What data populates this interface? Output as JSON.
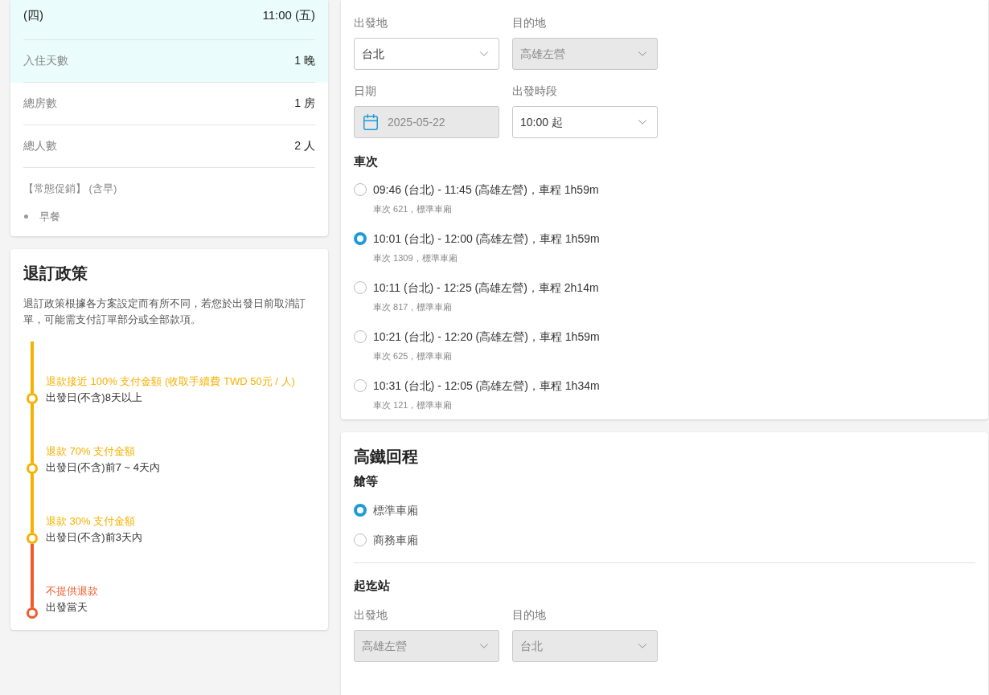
{
  "stay_summary": {
    "rows": [
      {
        "kind": "date",
        "label": "(四)",
        "value": "11:00 (五)",
        "highlighted": true
      },
      {
        "kind": "count",
        "label": "入住天數",
        "value": "1 晚",
        "highlighted": true
      },
      {
        "kind": "count",
        "label": "總房數",
        "value": "1 房",
        "highlighted": false
      },
      {
        "kind": "count",
        "label": "總人數",
        "value": "2 人",
        "highlighted": false
      }
    ],
    "plan": "【常態促銷】 (含早)",
    "inclusions": [
      "早餐"
    ]
  },
  "refund_policy": {
    "title": "退訂政策",
    "description": "退訂政策根據各方案設定而有所不同，若您於出發日前取消訂單，可能需支付訂單部分或全部款項。",
    "tiers": [
      {
        "refund": "退款接近 100% 支付金額 (收取手續費 TWD 50元 / 人)",
        "condition": "出發日(不含)8天以上",
        "color": "#f7b000"
      },
      {
        "refund": "退款 70% 支付金額",
        "condition": "出發日(不含)前7 ~ 4天內",
        "color": "#f7b000"
      },
      {
        "refund": "退款 30% 支付金額",
        "condition": "出發日(不含)前3天內",
        "color": "#f7b000"
      },
      {
        "refund": "不提供退款",
        "condition": "出發當天",
        "color": "#f25a28"
      }
    ]
  },
  "outbound": {
    "origin": {
      "label": "出發地",
      "value": "台北",
      "disabled": false
    },
    "destination": {
      "label": "目的地",
      "value": "高雄左營",
      "disabled": true
    },
    "date": {
      "label": "日期",
      "value": "2025-05-22",
      "disabled": true
    },
    "time": {
      "label": "出發時段",
      "value": "10:00 起",
      "disabled": false
    },
    "trains_heading": "車次",
    "trains": [
      {
        "route": "09:46 (台北) - 11:45 (高雄左營)，車程 1h59m",
        "detail": "車次 621，標準車廂",
        "selected": false
      },
      {
        "route": "10:01 (台北) - 12:00 (高雄左營)，車程 1h59m",
        "detail": "車次 1309，標準車廂",
        "selected": true
      },
      {
        "route": "10:11 (台北) - 12:25 (高雄左營)，車程 2h14m",
        "detail": "車次 817，標準車廂",
        "selected": false
      },
      {
        "route": "10:21 (台北) - 12:20 (高雄左營)，車程 1h59m",
        "detail": "車次 625，標準車廂",
        "selected": false
      },
      {
        "route": "10:31 (台北) - 12:05 (高雄左營)，車程 1h34m",
        "detail": "車次 121，標準車廂",
        "selected": false
      }
    ]
  },
  "return": {
    "title": "高鐵回程",
    "class_heading": "艙等",
    "classes": [
      {
        "label": "標準車廂",
        "selected": true
      },
      {
        "label": "商務車廂",
        "selected": false
      }
    ],
    "stations_heading": "起迄站",
    "origin": {
      "label": "出發地",
      "value": "高雄左營",
      "disabled": true
    },
    "destination": {
      "label": "目的地",
      "value": "台北",
      "disabled": true
    }
  }
}
